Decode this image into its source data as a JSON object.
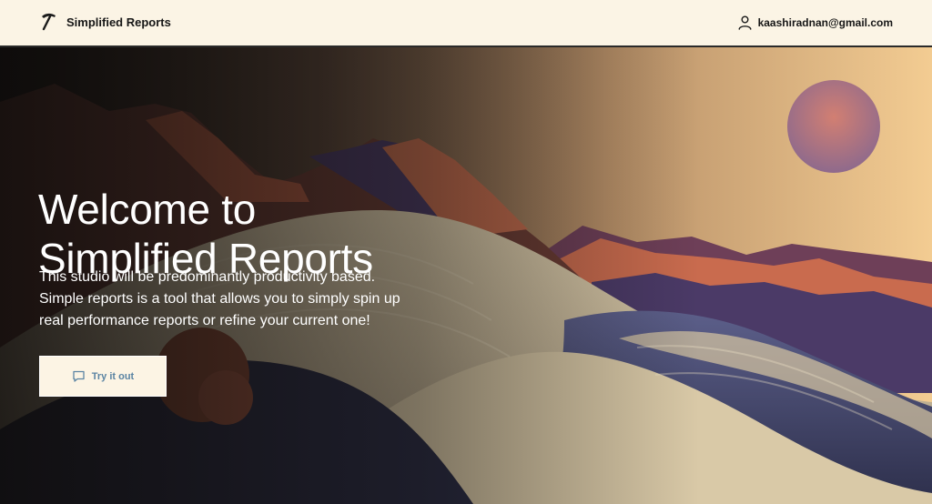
{
  "header": {
    "brand_name": "Simplified Reports",
    "brand_icon": "pickaxe-icon",
    "user_icon": "user-icon",
    "user_email": "kaashiradnan@gmail.com"
  },
  "hero": {
    "title_lines": [
      "Welcome to",
      "Simplified Reports"
    ],
    "description_lines": [
      "This studio will be predominantly productivity based.",
      "Simple reports is a tool that allows you to simply spin up",
      "real performance reports or refine your current one!"
    ],
    "cta_label": "Try it out",
    "cta_icon": "chat-bubble-icon"
  },
  "colors": {
    "header_bg": "#fbf4e5",
    "cta_bg": "#fcf4e4",
    "cta_text": "#5b84a3",
    "title_text": "#ffffff"
  }
}
